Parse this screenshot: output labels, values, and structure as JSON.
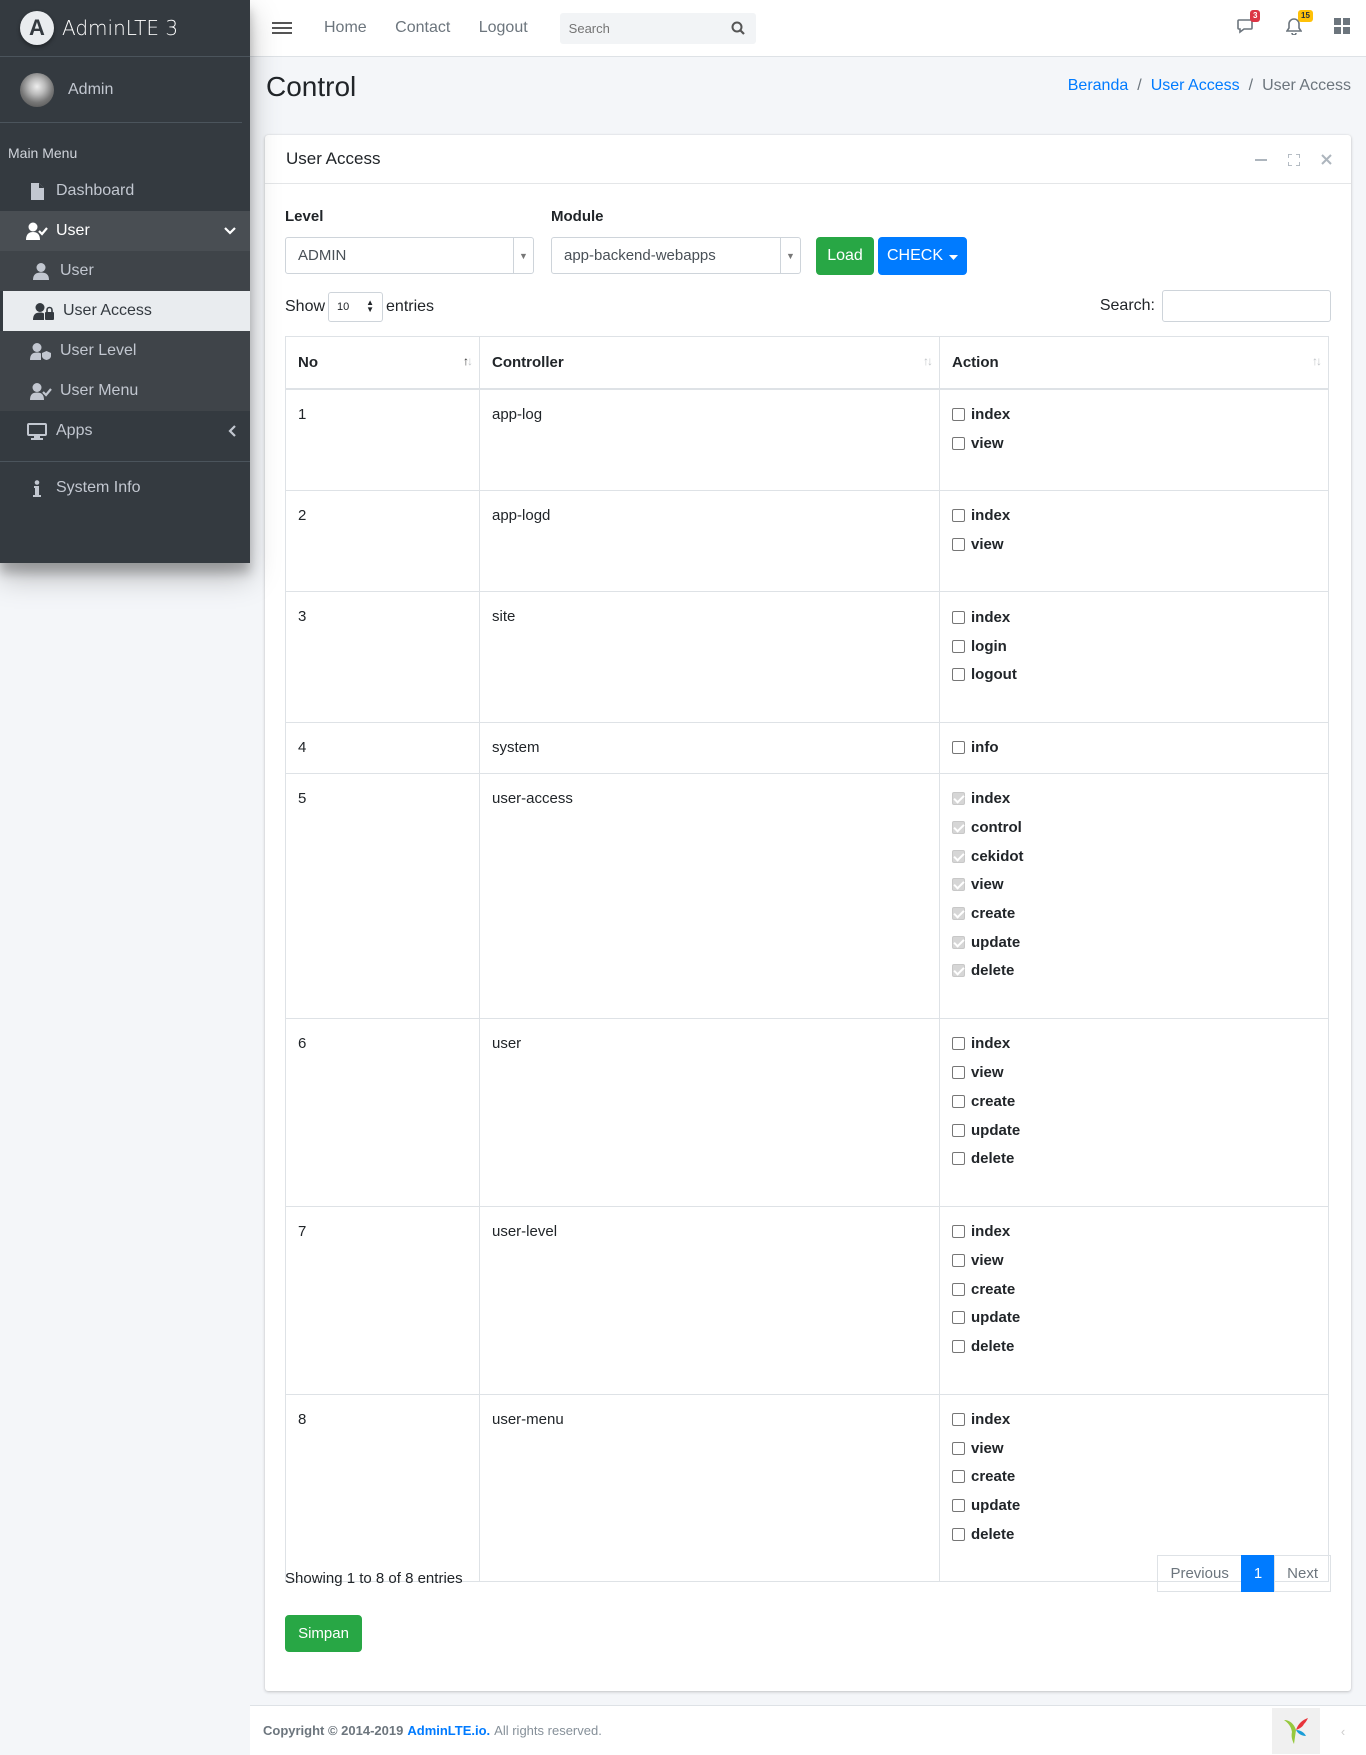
{
  "brand": {
    "logo_letter": "A",
    "name": "AdminLTE 3"
  },
  "user_panel": {
    "name": "Admin"
  },
  "sidebar": {
    "header": "Main Menu",
    "items": [
      {
        "label": "Dashboard",
        "icon": "file-icon"
      },
      {
        "label": "User",
        "icon": "user-check-icon"
      },
      {
        "label": "User",
        "icon": "user-icon"
      },
      {
        "label": "User Access",
        "icon": "user-lock-icon"
      },
      {
        "label": "User Level",
        "icon": "user-shield-icon"
      },
      {
        "label": "User Menu",
        "icon": "user-check-icon"
      },
      {
        "label": "Apps",
        "icon": "desktop-icon"
      },
      {
        "label": "System Info",
        "icon": "info-icon"
      }
    ]
  },
  "topbar": {
    "links": [
      "Home",
      "Contact",
      "Logout"
    ],
    "search_placeholder": "Search",
    "messages_badge": "3",
    "notifications_badge": "15"
  },
  "page": {
    "title": "Control",
    "breadcrumb": [
      "Beranda",
      "User Access",
      "User Access"
    ]
  },
  "card": {
    "title": "User Access",
    "level_label": "Level",
    "level_value": "ADMIN",
    "module_label": "Module",
    "module_value": "app-backend-webapps",
    "load_button": "Load",
    "check_button": "CHECK",
    "show_label": "Show",
    "entries_value": "10",
    "entries_label": "entries",
    "search_label": "Search:",
    "columns": [
      "No",
      "Controller",
      "Action"
    ],
    "rows": [
      {
        "no": "1",
        "controller": "app-log",
        "actions": [
          {
            "name": "index",
            "checked": false
          },
          {
            "name": "view",
            "checked": false
          }
        ]
      },
      {
        "no": "2",
        "controller": "app-logd",
        "actions": [
          {
            "name": "index",
            "checked": false
          },
          {
            "name": "view",
            "checked": false
          }
        ]
      },
      {
        "no": "3",
        "controller": "site",
        "actions": [
          {
            "name": "index",
            "checked": false
          },
          {
            "name": "login",
            "checked": false
          },
          {
            "name": "logout",
            "checked": false
          }
        ]
      },
      {
        "no": "4",
        "controller": "system",
        "actions": [
          {
            "name": "info",
            "checked": false
          }
        ]
      },
      {
        "no": "5",
        "controller": "user-access",
        "actions": [
          {
            "name": "index",
            "checked": true
          },
          {
            "name": "control",
            "checked": true
          },
          {
            "name": "cekidot",
            "checked": true
          },
          {
            "name": "view",
            "checked": true
          },
          {
            "name": "create",
            "checked": true
          },
          {
            "name": "update",
            "checked": true
          },
          {
            "name": "delete",
            "checked": true
          }
        ]
      },
      {
        "no": "6",
        "controller": "user",
        "actions": [
          {
            "name": "index",
            "checked": false
          },
          {
            "name": "view",
            "checked": false
          },
          {
            "name": "create",
            "checked": false
          },
          {
            "name": "update",
            "checked": false
          },
          {
            "name": "delete",
            "checked": false
          }
        ]
      },
      {
        "no": "7",
        "controller": "user-level",
        "actions": [
          {
            "name": "index",
            "checked": false
          },
          {
            "name": "view",
            "checked": false
          },
          {
            "name": "create",
            "checked": false
          },
          {
            "name": "update",
            "checked": false
          },
          {
            "name": "delete",
            "checked": false
          }
        ]
      },
      {
        "no": "8",
        "controller": "user-menu",
        "actions": [
          {
            "name": "index",
            "checked": false
          },
          {
            "name": "view",
            "checked": false
          },
          {
            "name": "create",
            "checked": false
          },
          {
            "name": "update",
            "checked": false
          },
          {
            "name": "delete",
            "checked": false
          }
        ]
      }
    ],
    "info": "Showing 1 to 8 of 8 entries",
    "pager": {
      "previous": "Previous",
      "current": "1",
      "next": "Next"
    },
    "save_button": "Simpan"
  },
  "footer": {
    "copyright": "Copyright © 2014-2019",
    "link": "AdminLTE.io.",
    "rights": "All rights reserved."
  },
  "colors": {
    "sidebar": "#343a40",
    "primary": "#007bff",
    "success": "#28a745"
  }
}
